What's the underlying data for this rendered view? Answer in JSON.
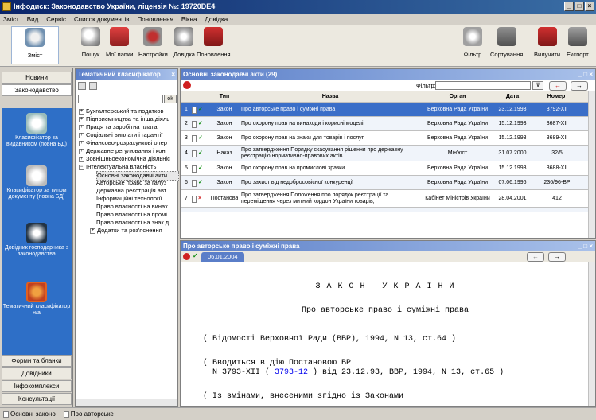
{
  "window": {
    "title": "Інфодиск: Законодавство України, ліцензія №: 19720DE4"
  },
  "menu": [
    "Зміст",
    "Вид",
    "Сервіс",
    "Список документів",
    "Поновлення",
    "Вікна",
    "Довідка"
  ],
  "toolbar": {
    "zmist": "Зміст",
    "poshuk": "Пошук",
    "papky": "Мої папки",
    "nastroiky": "Настройки",
    "dovidka": "Довідка",
    "ponovlennia": "Поновлення",
    "filtr": "Фільтр",
    "sortuvannia": "Сортування",
    "vyluchyty": "Вилучити",
    "eksport": "Експорт"
  },
  "nav": {
    "novyny": "Новини",
    "zakonodavstvo": "Законодавство",
    "item1": "Класифікатор за видавником (повна БД)",
    "item2": "Класифікатор за типом документу (повна БД)",
    "item3": "Довідник господарника з законодавства",
    "item4": "Тематичний класифікатор н/а",
    "formy": "Форми та бланки",
    "dovidnyky": "Довідники",
    "infokompleksy": "Інфокомплекси",
    "konsultatsii": "Консультації"
  },
  "tree": {
    "title": "Тематичний класифікатор",
    "ok": "ok",
    "items": [
      "Бухгалтерський та податков",
      "Підприємництва та інша діяль",
      "Праця та заробітна плата",
      "Соціальні виплати і гарантії",
      "Фінансово-розрахункові опер",
      "Державне регулювання і кон",
      "Зовнішньоекономічна діяльніс",
      "Інтелектуальна власність",
      "Основні законодавчі акти",
      "Авторське право за галуз",
      "Державна реєстрація авт",
      "Інформаційні технології",
      "Право власності на винах",
      "Право власності на промі",
      "Право власності на знак д",
      "Додатки та роз'яснення"
    ]
  },
  "docs": {
    "title": "Основні законодавчі акти (29)",
    "filter_label": "Фільтр:",
    "headers": [
      "Тип",
      "Назва",
      "Орган",
      "Дата",
      "Номер"
    ],
    "rows": [
      {
        "n": "1",
        "type": "Закон",
        "name": "Про авторське право і суміжні права",
        "organ": "Верховна Рада України",
        "date": "23.12.1993",
        "num": "3792-XII"
      },
      {
        "n": "2",
        "type": "Закон",
        "name": "Про охорону прав на винаходи і корисні моделі",
        "organ": "Верховна Рада України",
        "date": "15.12.1993",
        "num": "3687-XII"
      },
      {
        "n": "3",
        "type": "Закон",
        "name": "Про охорону прав на знаки для товарів і послуг",
        "organ": "Верховна Рада України",
        "date": "15.12.1993",
        "num": "3689-XII"
      },
      {
        "n": "4",
        "type": "Наказ",
        "name": "Про затвердження Порядку скасування рішення про державну реєстрацію нормативно-правових актів.",
        "organ": "Мін'юст",
        "date": "31.07.2000",
        "num": "32/5"
      },
      {
        "n": "5",
        "type": "Закон",
        "name": "Про охорону прав на промислові зразки",
        "organ": "Верховна Рада України",
        "date": "15.12.1993",
        "num": "3688-XII"
      },
      {
        "n": "6",
        "type": "Закон",
        "name": "Про захист від недобросовісної конкуренції",
        "organ": "Верховна Рада України",
        "date": "07.06.1996",
        "num": "236/96-ВР"
      },
      {
        "n": "7",
        "type": "Постанова",
        "name": "Про затвердження Положення про порядок реєстрації та переміщення через митний кордон України товарів,",
        "organ": "Кабінет Міністрів України",
        "date": "28.04.2001",
        "num": "412"
      }
    ]
  },
  "text": {
    "title": "Про авторське право і суміжні права",
    "tab_date": "06.01.2004",
    "heading": "З А К О Н   У К Р А Ї Н И",
    "subheading": "Про авторське право і суміжні права",
    "line1": "( Відомості Верховної Ради (ВВР), 1994, N 13, ст.64 )",
    "line2": "( Вводиться в дію Постановою ВР",
    "line3a": "  N 3793-XII ( ",
    "line3link": "3793-12",
    "line3b": " ) від 23.12.93, ВВР, 1994, N 13, ст.65 )",
    "line4": "( Із змінами, внесеними згідно із Законами"
  },
  "status": {
    "tab1": "Основні законо",
    "tab2": "Про авторське"
  },
  "colors": {
    "accent": "#2e6fc7",
    "titlebar": "#0a246a",
    "selected": "#3a6ec8",
    "link": "#0000ee"
  }
}
